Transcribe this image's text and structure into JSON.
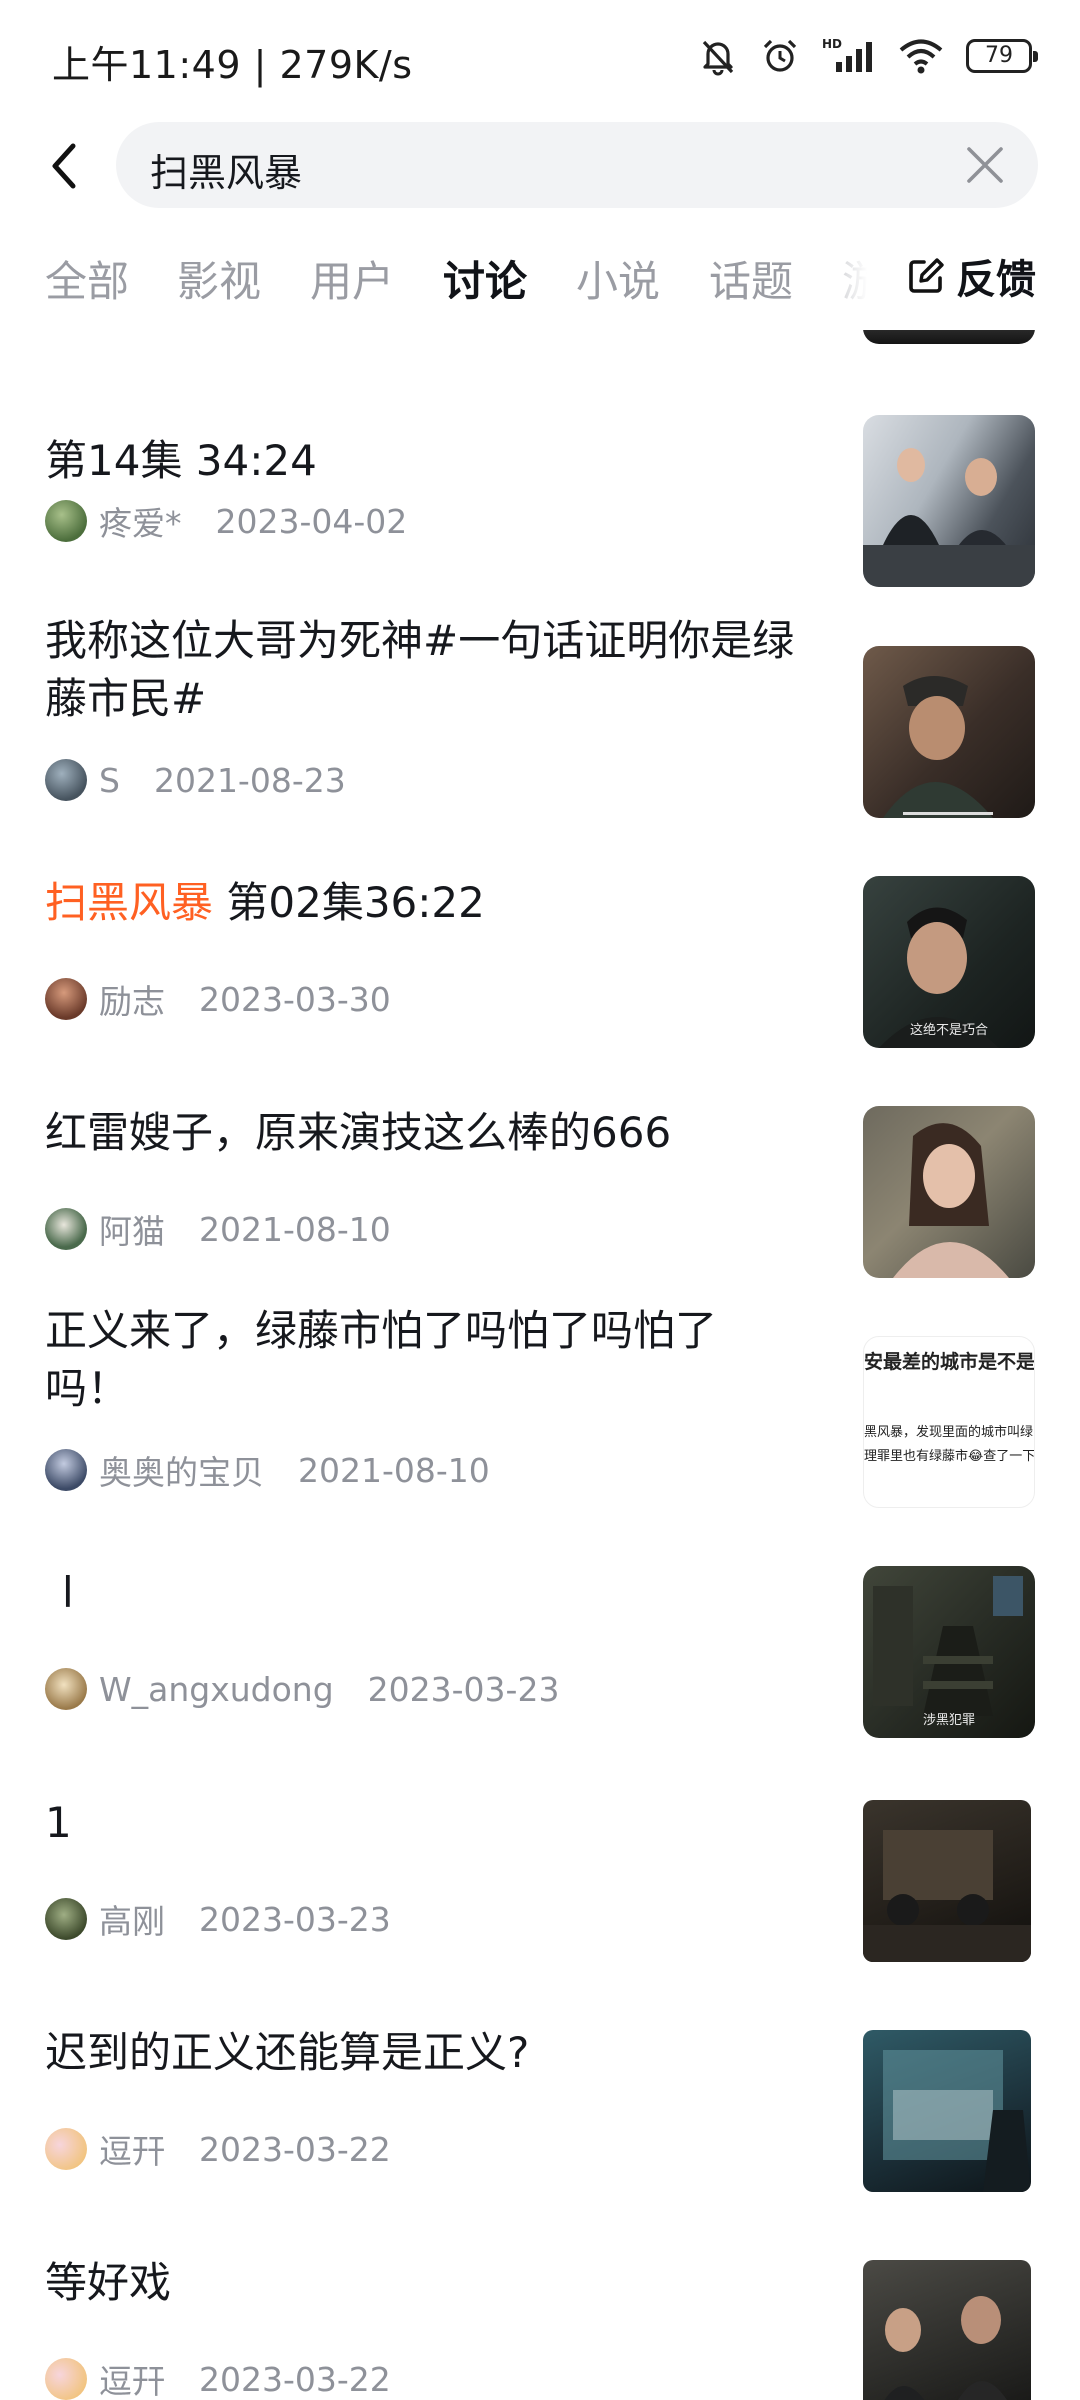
{
  "status_bar": {
    "time": "上午11:49 | 279K/s",
    "battery": "79"
  },
  "search": {
    "query": "扫黑风暴"
  },
  "tabs": [
    {
      "label": "全部",
      "active": false
    },
    {
      "label": "影视",
      "active": false
    },
    {
      "label": "用户",
      "active": false
    },
    {
      "label": "讨论",
      "active": true
    },
    {
      "label": "小说",
      "active": false
    },
    {
      "label": "话题",
      "active": false
    },
    {
      "label": "游",
      "active": false
    }
  ],
  "feedback": {
    "label": "反馈"
  },
  "items": [
    {
      "title": "第14集 34:24",
      "author": "疼爱*",
      "date": "2023-04-02",
      "avatar_color": "#6b8f5a"
    },
    {
      "title": "我称这位大哥为死神#一句话证明你是绿藤市民#",
      "author": "S",
      "date": "2021-08-23",
      "avatar_color": "#5f6e78"
    },
    {
      "title_highlight": "扫黑风暴",
      "title": "第02集36:22",
      "author": "励志",
      "date": "2023-03-30",
      "avatar_color": "#9a5a44",
      "thumb_caption": "这绝不是巧合"
    },
    {
      "title": "红雷嫂子，原来演技这么棒的666",
      "author": "阿猫",
      "date": "2021-08-10",
      "avatar_color": "#4e6b52"
    },
    {
      "title": "正义来了，绿藤市怕了吗怕了吗怕了吗！",
      "author": "奥奥的宝贝",
      "date": "2021-08-10",
      "avatar_color": "#53627a",
      "thumb_lines": [
        "安最差的城市是不是",
        "黑风暴，发现里面的城市叫绿",
        "理罪里也有绿藤市😂查了一下"
      ]
    },
    {
      "title": "l",
      "author": "W_angxudong",
      "date": "2023-03-23",
      "avatar_color": "#b89a6a",
      "thumb_caption": "涉黑犯罪"
    },
    {
      "title": "1",
      "author": "高刚",
      "date": "2023-03-23",
      "avatar_color": "#55623e"
    },
    {
      "title": "迟到的正义还能算是正义?",
      "author": "逗幵",
      "date": "2023-03-22",
      "avatar_color": "#f2c6cf"
    },
    {
      "title": "等好戏",
      "author": "逗幵",
      "date": "2023-03-22",
      "avatar_color": "#f2c6cf"
    }
  ]
}
